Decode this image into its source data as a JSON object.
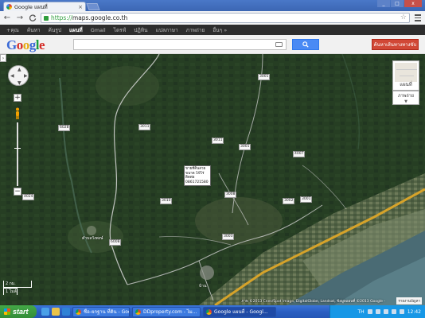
{
  "browser": {
    "tab_title": "Google แผนที่",
    "tab_close": "×",
    "url_scheme": "https://",
    "url_host": "maps.google.co.th",
    "back": "←",
    "forward": "→",
    "reload": "C",
    "star": "☆"
  },
  "gbar": {
    "items": [
      "+คุณ",
      "ค้นหา",
      "ค้นรูป",
      "แผนที่",
      "Gmail",
      "ไดรฟ์",
      "ปฏิทิน",
      "แปลภาษา",
      "ภาพถ่าย",
      "อื่นๆ »"
    ]
  },
  "header": {
    "logo": [
      "G",
      "o",
      "o",
      "g",
      "l",
      "e"
    ],
    "directions_label": "ค้นหาเส้นทางทางขับ"
  },
  "map": {
    "mapview_label": "แผนที่",
    "earth_label": "ภาพถ่าย",
    "road_labels": [
      {
        "id": "r3001a",
        "text": "3001"
      },
      {
        "id": "r3011a",
        "text": "3011"
      },
      {
        "id": "r3011b",
        "text": "3011"
      },
      {
        "id": "r3001b",
        "text": "3001"
      },
      {
        "id": "r4007",
        "text": "4007"
      },
      {
        "id": "r6028",
        "text": "6028"
      },
      {
        "id": "r4024",
        "text": "4024"
      },
      {
        "id": "r3010",
        "text": "3010"
      },
      {
        "id": "r3008a",
        "text": "3008"
      },
      {
        "id": "r3002",
        "text": "3002"
      },
      {
        "id": "r3001c",
        "text": "3001"
      },
      {
        "id": "r3003",
        "text": "3003"
      },
      {
        "id": "r6008",
        "text": "6008"
      }
    ],
    "place_labels": [
      {
        "id": "p1",
        "text": "ตำบลวังพงษ์"
      },
      {
        "id": "p2",
        "text": "บ้าน"
      }
    ],
    "info_label": [
      "ขายที่ดินสวย",
      "ขนาด 59ไร่",
      "ติดต่อ",
      "0861721580"
    ],
    "scale": {
      "top": "2 กม.",
      "bottom": "1 ไมล์"
    },
    "copyright": "ภาพ ©2013 Cnes/Spot Image, DigitalGlobe, Landsat, ข้อมูลแผนที่ ©2013 Google -",
    "report": "รายงานปัญหา"
  },
  "taskbar": {
    "start": "start",
    "items": [
      {
        "label": "ชื่อ-ยกฐาน ที่ดิน - Goo...",
        "active": false
      },
      {
        "label": "DDproperty.com - ไม...",
        "active": false
      },
      {
        "label": "Google แผนที่ - Googl...",
        "active": true
      }
    ],
    "tray_lang": "TH",
    "clock": "12:42"
  },
  "colors": {
    "map_dark": "#22381f",
    "coast": "#4a6b74",
    "highway": "#d6a32a",
    "gbar_bg": "#2d2d2d",
    "directions_red": "#d14836",
    "search_blue": "#4a8af4"
  }
}
